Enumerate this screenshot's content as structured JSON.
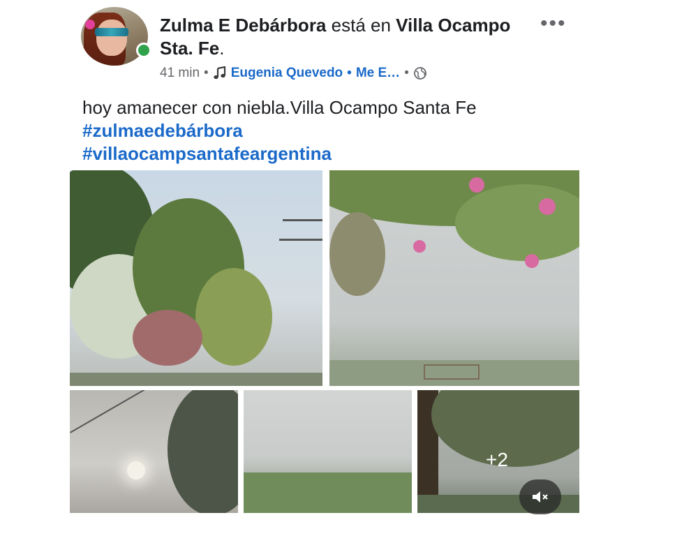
{
  "post": {
    "author": "Zulma E Debárbora",
    "connector": " está en ",
    "place": "Villa Ocampo Sta. Fe",
    "place_suffix": ".",
    "time": "41 min",
    "music_artist": "Eugenia Quevedo",
    "music_title": "Me E…",
    "text": "hoy amanecer con niebla.Villa Ocampo Santa Fe",
    "hashtags": [
      "#zulmaedebárbora",
      "#villaocampsantafeargentina"
    ],
    "more_photos": "+2"
  },
  "icons": {
    "menu": "more-horizontal-icon",
    "music": "music-note-icon",
    "privacy": "globe-icon",
    "mute": "speaker-mute-icon"
  },
  "colors": {
    "link": "#1b6ac9",
    "online": "#31a24c",
    "meta": "#65676b"
  }
}
